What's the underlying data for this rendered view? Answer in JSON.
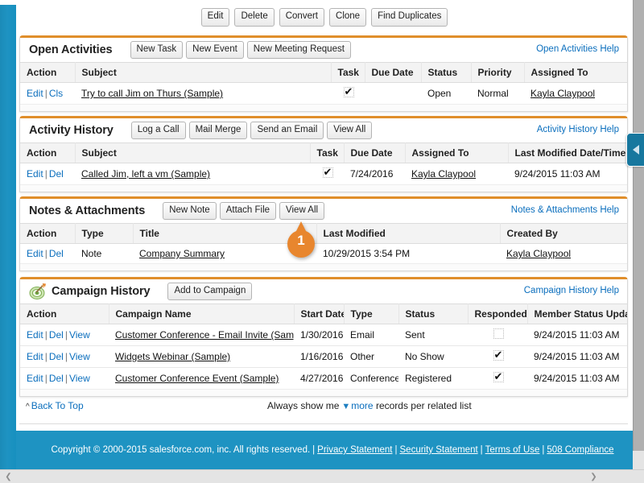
{
  "toolbar": {
    "buttons": [
      "Edit",
      "Delete",
      "Convert",
      "Clone",
      "Find Duplicates"
    ]
  },
  "callout": {
    "number": "1",
    "color": "#e8862e"
  },
  "side_tab": {
    "icon": "chevron-left-icon"
  },
  "related_lists": [
    {
      "title": "Open Activities",
      "icon": null,
      "buttons": [
        "New Task",
        "New Event",
        "New Meeting Request"
      ],
      "help_label": "Open Activities Help",
      "columns": [
        "Action",
        "Subject",
        "Task",
        "Due Date",
        "Status",
        "Priority",
        "Assigned To"
      ],
      "rows": [
        {
          "actions": [
            "Edit",
            "Cls"
          ],
          "subject": "Try to call Jim on Thurs (Sample)",
          "task": true,
          "due_date": "",
          "status": "Open",
          "priority": "Normal",
          "assigned_to": "Kayla Claypool"
        }
      ]
    },
    {
      "title": "Activity History",
      "icon": null,
      "buttons": [
        "Log a Call",
        "Mail Merge",
        "Send an Email",
        "View All"
      ],
      "help_label": "Activity History Help",
      "columns": [
        "Action",
        "Subject",
        "Task",
        "Due Date",
        "Assigned To",
        "Last Modified Date/Time"
      ],
      "rows": [
        {
          "actions": [
            "Edit",
            "Del"
          ],
          "subject": "Called Jim, left a vm (Sample)",
          "task": true,
          "due_date": "7/24/2016",
          "assigned_to": "Kayla Claypool",
          "last_modified": "9/24/2015 11:03 AM"
        }
      ]
    },
    {
      "title": "Notes & Attachments",
      "icon": null,
      "buttons": [
        "New Note",
        "Attach File",
        "View All"
      ],
      "help_label": "Notes & Attachments Help",
      "columns": [
        "Action",
        "Type",
        "Title",
        "Last Modified",
        "Created By"
      ],
      "rows": [
        {
          "actions": [
            "Edit",
            "Del"
          ],
          "type": "Note",
          "title": "Company Summary",
          "last_modified": "10/29/2015 3:54 PM",
          "created_by": "Kayla Claypool"
        }
      ]
    },
    {
      "title": "Campaign History",
      "icon": "campaign-target-icon",
      "buttons": [
        "Add to Campaign"
      ],
      "help_label": "Campaign History Help",
      "columns": [
        "Action",
        "Campaign Name",
        "Start Date",
        "Type",
        "Status",
        "Responded",
        "Member Status Update"
      ],
      "rows": [
        {
          "actions": [
            "Edit",
            "Del",
            "View"
          ],
          "campaign_name": "Customer Conference - Email Invite (Sample)",
          "start_date": "1/30/2016",
          "type": "Email",
          "status": "Sent",
          "responded": false,
          "member_status_update": "9/24/2015 11:03 AM"
        },
        {
          "actions": [
            "Edit",
            "Del",
            "View"
          ],
          "campaign_name": "Widgets Webinar (Sample)",
          "start_date": "1/16/2016",
          "type": "Other",
          "status": "No Show",
          "responded": true,
          "member_status_update": "9/24/2015 11:03 AM"
        },
        {
          "actions": [
            "Edit",
            "Del",
            "View"
          ],
          "campaign_name": "Customer Conference Event (Sample)",
          "start_date": "4/27/2016",
          "type": "Conference",
          "status": "Registered",
          "responded": true,
          "member_status_update": "9/24/2015 11:03 AM"
        }
      ]
    }
  ],
  "bottom": {
    "back_to_top": "Back To Top",
    "always_show_prefix": "Always show me",
    "more_label": "more",
    "always_show_suffix": "records per related list"
  },
  "footer": {
    "copyright": "Copyright © 2000-2015 salesforce.com, inc. All rights reserved.",
    "links": [
      "Privacy Statement",
      "Security Statement",
      "Terms of Use",
      "508 Compliance"
    ],
    "background": "#1e93c2"
  }
}
